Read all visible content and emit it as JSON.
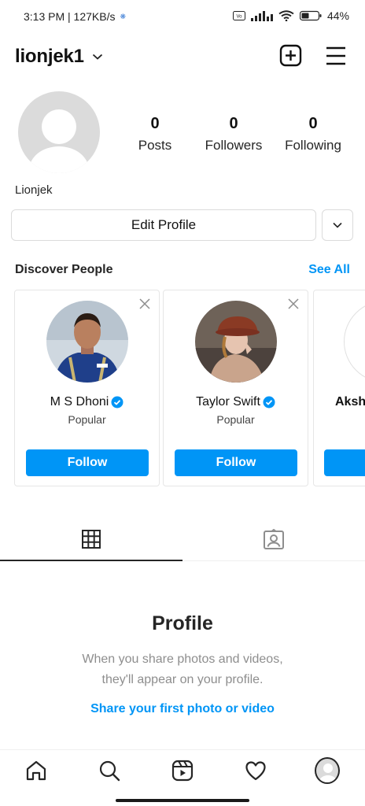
{
  "status_bar": {
    "time": "3:13 PM | 127KB/s",
    "battery": "44"
  },
  "header": {
    "username": "lionjek1",
    "icons": [
      "chevron-down-icon",
      "plus-square-icon",
      "menu-icon"
    ]
  },
  "profile": {
    "display_name": "Lionjek",
    "stats": [
      {
        "value": "0",
        "label": "Posts"
      },
      {
        "value": "0",
        "label": "Followers"
      },
      {
        "value": "0",
        "label": "Following"
      }
    ],
    "edit_label": "Edit Profile"
  },
  "discover": {
    "title": "Discover People",
    "see_all": "See All",
    "cards": [
      {
        "name": "M S Dhoni",
        "sub": "Popular",
        "button": "Follow"
      },
      {
        "name": "Taylor Swift",
        "sub": "Popular",
        "button": "Follow"
      }
    ],
    "partial_card_name": "Aksh"
  },
  "tabs": [
    "grid-icon",
    "tagged-icon"
  ],
  "empty_state": {
    "title": "Profile",
    "line1": "When you share photos and videos,",
    "line2": "they'll appear on your profile.",
    "link": "Share your first photo or video"
  },
  "bottom_nav": [
    "home-icon",
    "search-icon",
    "reels-icon",
    "heart-icon",
    "profile-avatar"
  ],
  "colors": {
    "accent": "#0095f6",
    "text": "#262626",
    "muted": "#8e8e8e",
    "border": "#dbdbdb"
  }
}
